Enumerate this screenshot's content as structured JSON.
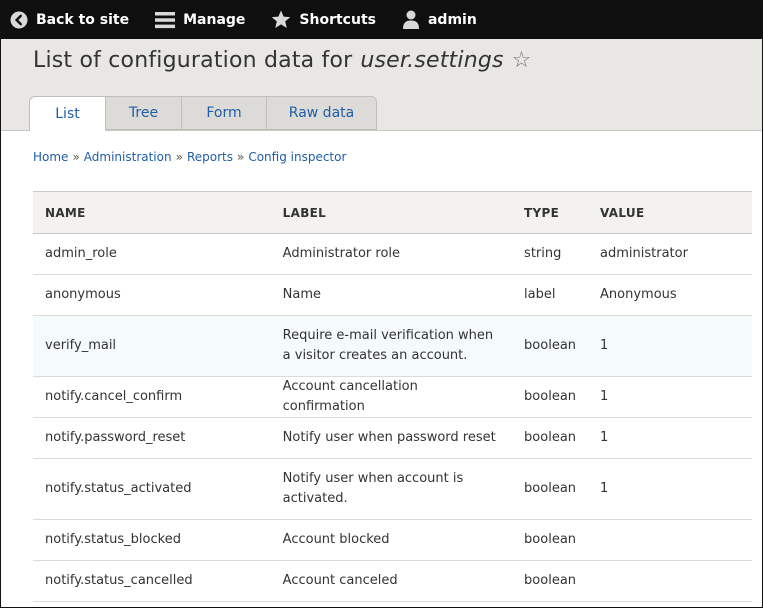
{
  "toolbar": {
    "back": "Back to site",
    "manage": "Manage",
    "shortcuts": "Shortcuts",
    "user": "admin"
  },
  "header": {
    "title_prefix": "List of configuration data for",
    "title_name": "user.settings",
    "tabs": [
      {
        "label": "List"
      },
      {
        "label": "Tree"
      },
      {
        "label": "Form"
      },
      {
        "label": "Raw data"
      }
    ]
  },
  "breadcrumb": [
    "Home",
    "Administration",
    "Reports",
    "Config inspector"
  ],
  "table": {
    "headers": [
      "NAME",
      "LABEL",
      "TYPE",
      "VALUE"
    ],
    "rows": [
      {
        "name": "admin_role",
        "label": "Administrator role",
        "type": "string",
        "value": "administrator"
      },
      {
        "name": "anonymous",
        "label": "Name",
        "type": "label",
        "value": "Anonymous"
      },
      {
        "name": "verify_mail",
        "label": "Require e-mail verification when a visitor creates an account.",
        "type": "boolean",
        "value": "1"
      },
      {
        "name": "notify.cancel_confirm",
        "label": "Account cancellation confirmation",
        "type": "boolean",
        "value": "1"
      },
      {
        "name": "notify.password_reset",
        "label": "Notify user when password reset",
        "type": "boolean",
        "value": "1"
      },
      {
        "name": "notify.status_activated",
        "label": "Notify user when account is activated.",
        "type": "boolean",
        "value": "1"
      },
      {
        "name": "notify.status_blocked",
        "label": "Account blocked",
        "type": "boolean",
        "value": ""
      },
      {
        "name": "notify.status_cancelled",
        "label": "Account canceled",
        "type": "boolean",
        "value": ""
      }
    ]
  },
  "colors": {
    "toolbar_bg": "#0f0f0f",
    "header_bg": "#e8e7e3",
    "link": "#1f5ea8",
    "row_highlight": "#f5fafd"
  }
}
